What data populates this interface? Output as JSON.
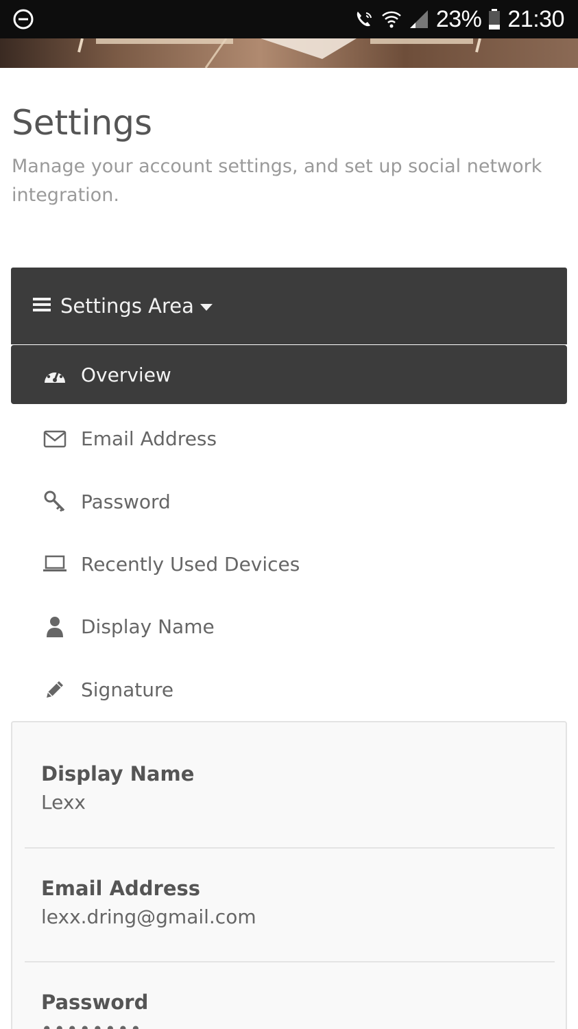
{
  "status_bar": {
    "battery": "23%",
    "time": "21:30"
  },
  "header": {
    "title": "Settings",
    "subtitle": "Manage your account settings, and set up social network integration."
  },
  "settings_area": {
    "label": "Settings Area"
  },
  "menu": {
    "items": [
      {
        "label": "Overview",
        "icon": "dashboard-icon"
      },
      {
        "label": "Email Address",
        "icon": "envelope-icon"
      },
      {
        "label": "Password",
        "icon": "key-icon"
      },
      {
        "label": "Recently Used Devices",
        "icon": "laptop-icon"
      },
      {
        "label": "Display Name",
        "icon": "user-icon"
      },
      {
        "label": "Signature",
        "icon": "pencil-icon"
      }
    ]
  },
  "overview": {
    "display_name_label": "Display Name",
    "display_name_value": "Lexx",
    "email_label": "Email Address",
    "email_value": "lexx.dring@gmail.com",
    "password_label": "Password",
    "password_value": "••••••••"
  },
  "colors": {
    "dark_bar": "#3c3c3c",
    "text": "#555555",
    "muted": "#9a9a9a"
  }
}
